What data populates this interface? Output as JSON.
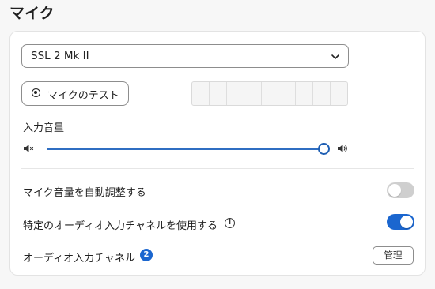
{
  "section": {
    "title": "マイク"
  },
  "device_select": {
    "value": "SSL 2 Mk II",
    "icon": "chevron-down-icon"
  },
  "mic_test": {
    "label": "マイクのテスト",
    "icon": "radio-dot-icon"
  },
  "level_meter": {
    "segments": 9,
    "level": 0
  },
  "input_volume": {
    "label": "入力音量",
    "level": 1.0,
    "mute_icon": "speaker-mute-icon",
    "max_icon": "speaker-loud-icon"
  },
  "auto_adjust": {
    "label": "マイク音量を自動調整する",
    "enabled": false
  },
  "specific_channel": {
    "label": "特定のオーディオ入力チャネルを使用する",
    "info_icon": "i",
    "enabled": true
  },
  "audio_channel": {
    "label": "オーディオ入力チャネル",
    "count": "2",
    "manage_label": "管理"
  },
  "colors": {
    "accent": "#1b66cf",
    "slider": "#2f6ec2",
    "toggle_off": "#cfcfcf"
  }
}
